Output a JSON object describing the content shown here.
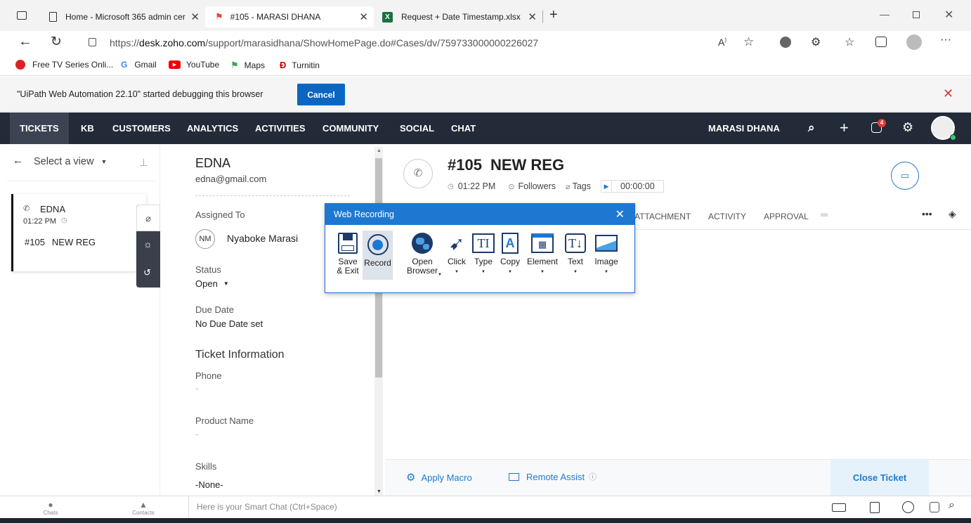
{
  "browser": {
    "tabs": [
      {
        "title": "Home - Microsoft 365 admin cer"
      },
      {
        "title": "#105 - MARASI DHANA"
      },
      {
        "title": "Request + Date Timestamp.xlsx"
      }
    ],
    "url_prefix": "https://",
    "url_domain": "desk.zoho.com",
    "url_path": "/support/marasidhana/ShowHomePage.do#Cases/dv/759733000000226027",
    "bookmarks": [
      "Free TV Series Onli...",
      "Gmail",
      "YouTube",
      "Maps",
      "Turnitin"
    ],
    "debug_message": "\"UiPath Web Automation 22.10\" started debugging this browser",
    "debug_cancel": "Cancel"
  },
  "nav": {
    "items": [
      "TICKETS",
      "KB",
      "CUSTOMERS",
      "ANALYTICS",
      "ACTIVITIES",
      "COMMUNITY",
      "SOCIAL",
      "CHAT"
    ],
    "user": "MARASI DHANA",
    "notification_count": "4"
  },
  "left": {
    "view_select": "Select a view",
    "ticket_name": "EDNA",
    "ticket_time": "01:22 PM",
    "ticket_id": "#105",
    "ticket_subject": "NEW REG"
  },
  "detail": {
    "name": "EDNA",
    "email": "edna@gmail.com",
    "assigned_label": "Assigned To",
    "assignee_initials": "NM",
    "assignee": "Nyaboke Marasi",
    "status_label": "Status",
    "status": "Open",
    "due_label": "Due Date",
    "due_value": "No Due Date set",
    "section": "Ticket Information",
    "phone_label": "Phone",
    "phone_value": "-",
    "product_label": "Product Name",
    "product_value": "-",
    "skills_label": "Skills",
    "skills_value": "-None-"
  },
  "main": {
    "ticket_id": "#105",
    "ticket_title": "NEW REG",
    "time": "01:22 PM",
    "followers": "Followers",
    "tags": "Tags",
    "timer": "00:00:00",
    "tabs": [
      "ATTACHMENT",
      "ACTIVITY",
      "APPROVAL"
    ],
    "apply_macro": "Apply Macro",
    "remote_assist": "Remote Assist",
    "close_ticket": "Close Ticket"
  },
  "recorder": {
    "title": "Web Recording",
    "tools": [
      {
        "label": "Save\n& Exit"
      },
      {
        "label": "Record"
      },
      {
        "label": "Open\nBrowser"
      },
      {
        "label": "Click"
      },
      {
        "label": "Type"
      },
      {
        "label": "Copy"
      },
      {
        "label": "Element"
      },
      {
        "label": "Text"
      },
      {
        "label": "Image"
      }
    ]
  },
  "statusbar": {
    "chats": "Chats",
    "contacts": "Contacts",
    "smart_chat_placeholder": "Here is your Smart Chat (Ctrl+Space)"
  },
  "colors": {
    "nav_bg": "#232a38",
    "accent": "#1e78d2",
    "excel_green": "#1d6f42"
  }
}
